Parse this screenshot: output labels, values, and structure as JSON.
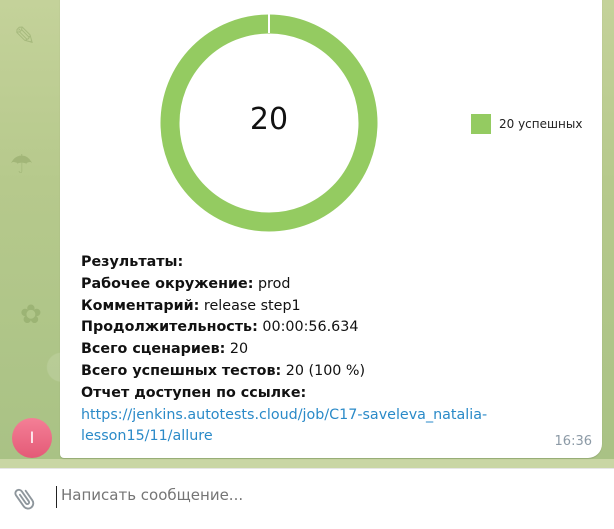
{
  "chart_data": {
    "type": "pie",
    "center_value": "20",
    "slices": [
      {
        "name": "20 успешных",
        "value": 20,
        "color": "#94cb61"
      }
    ]
  },
  "message": {
    "results_label": "Результаты:",
    "env_label": "Рабочее окружение:",
    "env_value": " prod",
    "comment_label": "Комментарий:",
    "comment_value": " release step1",
    "duration_label": "Продолжительность:",
    "duration_value": " 00:00:56.634",
    "scenarios_label": "Всего сценариев:",
    "scenarios_value": " 20",
    "passed_label": "Всего успешных тестов:",
    "passed_value": " 20 (100 %)",
    "report_label": "Отчет доступен по ссылке:",
    "link_line1": "https://jenkins.autotests.cloud/job/C17-saveleva_natalia-",
    "link_line2": "lesson15/11/allure",
    "time": "16:36"
  },
  "avatar": {
    "initial": "I"
  },
  "composer": {
    "placeholder": "Написать сообщение..."
  },
  "icons": {
    "attach": "paperclip-icon"
  }
}
